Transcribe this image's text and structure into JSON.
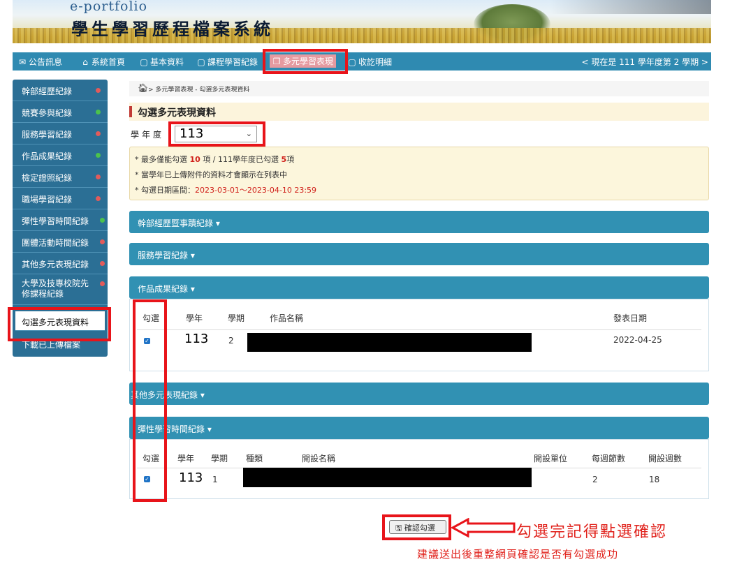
{
  "banner": {
    "brand_en": "e-portfolio",
    "brand_zh": "學生學習歷程檔案系統"
  },
  "nav": {
    "items": [
      "公告訊息",
      "系統首頁",
      "基本資料",
      "課程學習紀錄",
      "多元學習表現",
      "收訖明細"
    ],
    "term": "< 現在是 111 學年度第 2 學期 >"
  },
  "sidebar": {
    "items": [
      {
        "label": "幹部經歷紀錄",
        "dot": "#e25b5b"
      },
      {
        "label": "競賽參與紀錄",
        "dot": "#4cc24c"
      },
      {
        "label": "服務學習紀錄",
        "dot": "#e25b5b"
      },
      {
        "label": "作品成果紀錄",
        "dot": "#4cc24c"
      },
      {
        "label": "檢定證照紀錄",
        "dot": "#e25b5b"
      },
      {
        "label": "職場學習紀錄",
        "dot": "#e25b5b"
      },
      {
        "label": "彈性學習時間紀錄",
        "dot": "#4cc24c"
      },
      {
        "label": "團體活動時間紀錄",
        "dot": "#e25b5b"
      },
      {
        "label": "其他多元表現紀錄",
        "dot": "#e25b5b"
      },
      {
        "label": "大學及技專校院先修課程紀錄",
        "label_l1": "大學及技專校院先",
        "label_l2": "修課程紀錄",
        "dot": "#e25b5b"
      },
      {
        "label": "勾選多元表現資料",
        "dot": ""
      },
      {
        "label": "下載已上傳檔案",
        "dot": ""
      }
    ]
  },
  "breadcrumb": "> 多元學習表現 - 勾選多元表現資料",
  "page_title": "勾選多元表現資料",
  "year_select": {
    "label": "學年度",
    "value": "113"
  },
  "notice": {
    "line1_pre": "* 最多僅能勾選 ",
    "line1_max": "10",
    "line1_mid": " 項 / 111學年度已勾選 ",
    "line1_count": "5",
    "line1_post": "項",
    "line2": "* 當學年已上傳附件的資料才會顯示在列表中",
    "line3_pre": "* 勾選日期區間：",
    "line3_range": "2023-03-01～2023-04-10 23:59"
  },
  "panels": {
    "leader": "幹部經歷暨事蹟紀錄 ▾",
    "service": "服務學習紀錄 ▾",
    "works": {
      "title": "作品成果紀錄 ▾",
      "headers": [
        "勾選",
        "學年",
        "學期",
        "作品名稱",
        "發表日期"
      ],
      "row": {
        "year": "113",
        "term": "2",
        "date": "2022-04-25"
      }
    },
    "other": "其他多元表現紀錄 ▾",
    "flex": {
      "title": "彈性學習時間紀錄 ▾",
      "headers": [
        "勾選",
        "學年",
        "學期",
        "種類",
        "開設名稱",
        "開設單位",
        "每週節數",
        "開設週數"
      ],
      "row": {
        "year": "113",
        "term": "1",
        "weekly": "2",
        "weeks": "18"
      }
    }
  },
  "confirm_button": "確認勾選",
  "annotation": {
    "arrow_note": "勾選完記得點選確認",
    "bottom_note": "建議送出後重整網頁確認是否有勾選成功"
  },
  "colors": {
    "nav": "#2f8ab1",
    "sidebar": "#2b6f95",
    "panel": "#3191b3",
    "annotation_red": "#e8141a"
  }
}
